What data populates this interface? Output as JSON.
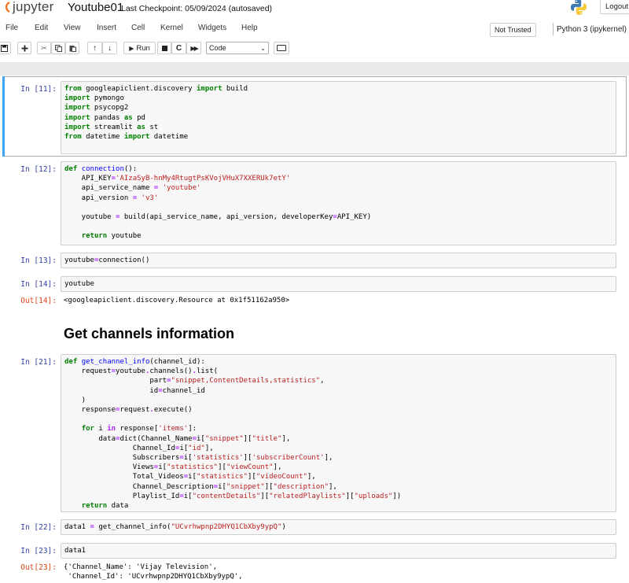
{
  "header": {
    "brand": "jupyter",
    "notebook_name": "Youtube01",
    "checkpoint": "Last Checkpoint: 05/09/2024  (autosaved)",
    "logout_label": "Logout"
  },
  "menu": [
    "File",
    "Edit",
    "View",
    "Insert",
    "Cell",
    "Kernel",
    "Widgets",
    "Help"
  ],
  "status": {
    "trust": "Not Trusted",
    "kernel": "Python 3 (ipykernel)"
  },
  "toolbar": {
    "run_label": "Run",
    "cell_type": "Code",
    "icons": [
      "save-icon",
      "plus-icon",
      "cut-icon",
      "copy-icon",
      "paste-icon",
      "move-up-icon",
      "move-down-icon",
      "run-icon",
      "stop-icon",
      "restart-icon",
      "fast-forward-icon",
      "keyboard-icon"
    ]
  },
  "cells": [
    {
      "prompt": "In [11]:",
      "code": "from googleapiclient.discovery import build\nimport pymongo\nimport psycopg2\nimport pandas as pd\nimport streamlit as st\nfrom datetime import datetime"
    },
    {
      "prompt": "In [12]:",
      "code": "def connection():\n    API_KEY='AIzaSyB-hnMy4RtugtPsKVojVHuX7XXERUk7etY'\n    api_service_name = 'youtube'\n    api_version = 'v3'\n\n    youtube = build(api_service_name, api_version, developerKey=API_KEY)\n\n    return youtube"
    },
    {
      "prompt": "In [13]:",
      "code": "youtube=connection()"
    },
    {
      "prompt": "In [14]:",
      "code": "youtube",
      "out_prompt": "Out[14]:",
      "output": "<googleapiclient.discovery.Resource at 0x1f51162a950>"
    },
    {
      "markdown": "Get channels information"
    },
    {
      "prompt": "In [21]:",
      "code": "def get_channel_info(channel_id):\n    request=youtube.channels().list(\n                    part=\"snippet,ContentDetails,statistics\",\n                    id=channel_id\n    )\n    response=request.execute()\n\n    for i in response['items']:\n        data=dict(Channel_Name=i[\"snippet\"][\"title\"],\n                Channel_Id=i[\"id\"],\n                Subscribers=i['statistics']['subscriberCount'],\n                Views=i[\"statistics\"][\"viewCount\"],\n                Total_Videos=i[\"statistics\"][\"videoCount\"],\n                Channel_Description=i[\"snippet\"][\"description\"],\n                Playlist_Id=i[\"contentDetails\"][\"relatedPlaylists\"][\"uploads\"])\n    return data"
    },
    {
      "prompt": "In [22]:",
      "code": "data1 = get_channel_info(\"UCvrhwpnp2DHYQ1CbXby9ypQ\")"
    },
    {
      "prompt": "In [23]:",
      "code": "data1",
      "out_prompt": "Out[23]:",
      "output": "{'Channel_Name': 'Vijay Television',\n 'Channel_Id': 'UCvrhwpnp2DHYQ1CbXby9ypQ',"
    }
  ]
}
